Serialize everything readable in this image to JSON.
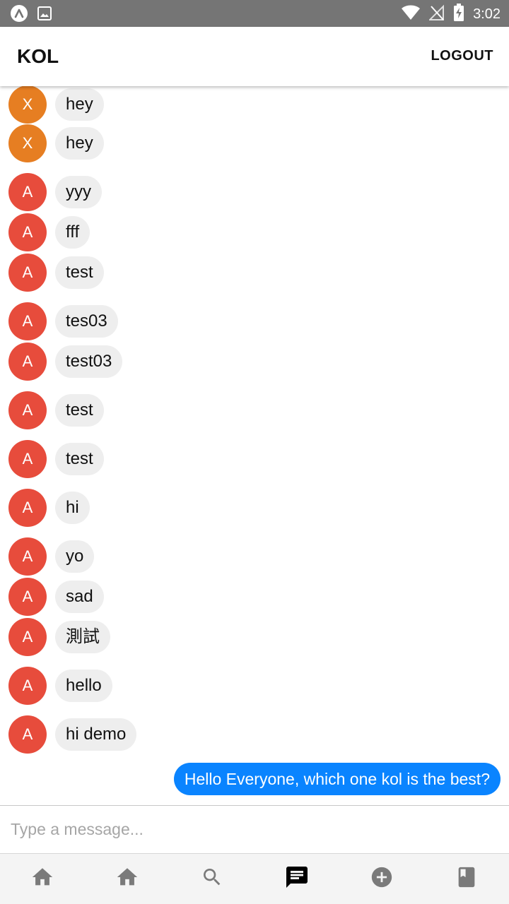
{
  "status_bar": {
    "time": "3:02",
    "icons": [
      "app-notification-icon",
      "image-notification-icon",
      "wifi-icon",
      "no-signal-icon",
      "battery-charging-icon"
    ]
  },
  "app_bar": {
    "title": "KOL",
    "logout_label": "LOGOUT"
  },
  "messages": [
    {
      "sender_initial": "X",
      "text": "hey",
      "avatar_color": "#E67E22"
    },
    {
      "sender_initial": "X",
      "text": "hey",
      "avatar_color": "#E67E22"
    },
    {
      "sender_initial": "A",
      "text": "yyy",
      "avatar_color": "#E74C3C"
    },
    {
      "sender_initial": "A",
      "text": "fff",
      "avatar_color": "#E74C3C"
    },
    {
      "sender_initial": "A",
      "text": "test",
      "avatar_color": "#E74C3C"
    },
    {
      "sender_initial": "A",
      "text": "tes03",
      "avatar_color": "#E74C3C"
    },
    {
      "sender_initial": "A",
      "text": "test03",
      "avatar_color": "#E74C3C"
    },
    {
      "sender_initial": "A",
      "text": "test",
      "avatar_color": "#E74C3C"
    },
    {
      "sender_initial": "A",
      "text": "test",
      "avatar_color": "#E74C3C"
    },
    {
      "sender_initial": "A",
      "text": "hi",
      "avatar_color": "#E74C3C"
    },
    {
      "sender_initial": "A",
      "text": "yo",
      "avatar_color": "#E74C3C"
    },
    {
      "sender_initial": "A",
      "text": "sad",
      "avatar_color": "#E74C3C"
    },
    {
      "sender_initial": "A",
      "text": "測試",
      "avatar_color": "#E74C3C"
    },
    {
      "sender_initial": "A",
      "text": "hello",
      "avatar_color": "#E74C3C"
    },
    {
      "sender_initial": "A",
      "text": "hi demo",
      "avatar_color": "#E74C3C"
    }
  ],
  "my_message": {
    "text": "Hello Everyone, which one kol is the best?",
    "bubble_color": "#0A84FF"
  },
  "composer": {
    "placeholder": "Type a message..."
  },
  "bottom_nav": {
    "items": [
      {
        "icon": "home-icon",
        "active": false
      },
      {
        "icon": "home-icon",
        "active": false
      },
      {
        "icon": "search-icon",
        "active": false
      },
      {
        "icon": "chat-icon",
        "active": true
      },
      {
        "icon": "add-circle-icon",
        "active": false
      },
      {
        "icon": "book-icon",
        "active": false
      }
    ],
    "active_color": "#000000",
    "inactive_color": "#7A7A7A"
  }
}
